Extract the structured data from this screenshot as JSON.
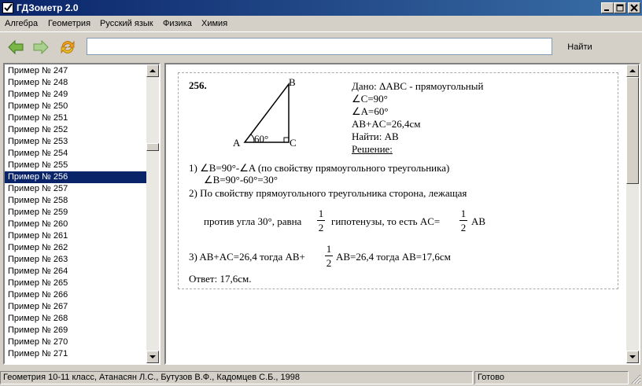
{
  "window": {
    "title": "ГДЗометр 2.0"
  },
  "menu": {
    "items": [
      "Алгебра",
      "Геометрия",
      "Русский язык",
      "Физика",
      "Химия"
    ]
  },
  "toolbar": {
    "back_icon": "arrow-left-icon",
    "forward_icon": "arrow-right-icon",
    "refresh_icon": "refresh-icon",
    "search_value": "",
    "find_label": "Найти"
  },
  "list": {
    "items": [
      "Пример № 247",
      "Пример № 248",
      "Пример № 249",
      "Пример № 250",
      "Пример № 251",
      "Пример № 252",
      "Пример № 253",
      "Пример № 254",
      "Пример № 255",
      "Пример № 256",
      "Пример № 257",
      "Пример № 258",
      "Пример № 259",
      "Пример № 260",
      "Пример № 261",
      "Пример № 262",
      "Пример № 263",
      "Пример № 264",
      "Пример № 265",
      "Пример № 266",
      "Пример № 267",
      "Пример № 268",
      "Пример № 269",
      "Пример № 270",
      "Пример № 271"
    ],
    "selected": "Пример № 256"
  },
  "solution": {
    "number": "256.",
    "vertex_a": "A",
    "vertex_b": "B",
    "vertex_c": "C",
    "angle_label": "60°",
    "given_1": "Дано: ΔABC - прямоугольный",
    "given_2": "∠C=90°",
    "given_3": "∠A=60°",
    "given_4": "AB+AC=26,4см",
    "find": "Найти: AB",
    "solution_heading": "Решение:",
    "step1a": "1) ∠B=90°-∠A (по свойству прямоугольного треугольника)",
    "step1b": "∠B=90°-60°=30°",
    "step2a": "2) По свойству прямоугольного треугольника сторона, лежащая",
    "step2b_pre": "против угла 30°, равна",
    "step2b_mid": "гипотенузы, то есть AC=",
    "step2b_post": "AB",
    "frac_num": "1",
    "frac_den": "2",
    "step3_pre": "3) AB+AC=26,4 тогда AB+",
    "step3_post": "AB=26,4 тогда AB=17,6см",
    "answer": "Ответ: 17,6см."
  },
  "status": {
    "book": "Геометрия 10-11 класс, Атанасян Л.С., Бутузов В.Ф., Кадомцев С.Б., 1998",
    "state": "Готово"
  }
}
